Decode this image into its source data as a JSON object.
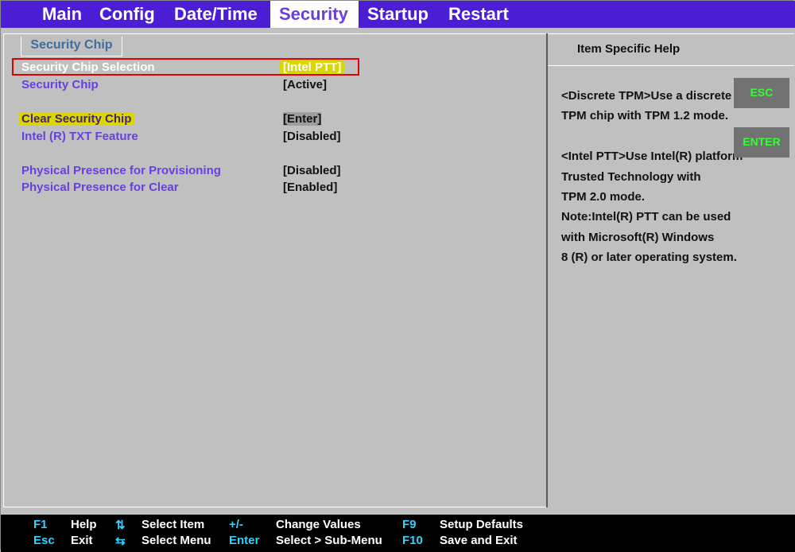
{
  "menubar": {
    "items": [
      "Main",
      "Config",
      "Date/Time",
      "Security",
      "Startup",
      "Restart"
    ],
    "active_index": 3
  },
  "section_tab": "Security Chip",
  "settings": [
    {
      "label": "Security Chip Selection",
      "value": "[Intel PTT]"
    },
    {
      "label": "Security Chip",
      "value": "[Active]"
    },
    {
      "label": "Clear Security Chip",
      "value": "[Enter]"
    },
    {
      "label": "Intel (R) TXT Feature",
      "value": "[Disabled]"
    },
    {
      "label": "Physical Presence for Provisioning",
      "value": "[Disabled]"
    },
    {
      "label": "Physical Presence for Clear",
      "value": "[Enabled]"
    }
  ],
  "help": {
    "title": "Item Specific Help",
    "lines": [
      "<Discrete TPM>Use a discrete",
      "TPM chip with TPM 1.2 mode.",
      "<Intel PTT>Use Intel(R) platform",
      "Trusted Technology with",
      "TPM 2.0 mode.",
      "Note:Intel(R) PTT can be used",
      "with Microsoft(R) Windows",
      "8 (R) or later operating system."
    ]
  },
  "badges": {
    "esc": "ESC",
    "enter": "ENTER"
  },
  "footer": {
    "row1": [
      {
        "key": "F1",
        "desc": "Help"
      },
      {
        "key": "⇅",
        "desc": "Select Item"
      },
      {
        "key": "+/-",
        "desc": "Change Values"
      },
      {
        "key": "F9",
        "desc": "Setup Defaults"
      }
    ],
    "row2": [
      {
        "key": "Esc",
        "desc": "Exit"
      },
      {
        "key": "⇆",
        "desc": "Select Menu"
      },
      {
        "key": "Enter",
        "desc": "Select > Sub-Menu"
      },
      {
        "key": "F10",
        "desc": "Save and Exit"
      }
    ]
  },
  "colors": {
    "menubar_bg": "#4b1ed6",
    "label": "#6a3fe0",
    "highlight": "#d8d800",
    "selection_border": "#e00000",
    "footer_key": "#2fd3ff",
    "badge_text": "#33ff33"
  }
}
